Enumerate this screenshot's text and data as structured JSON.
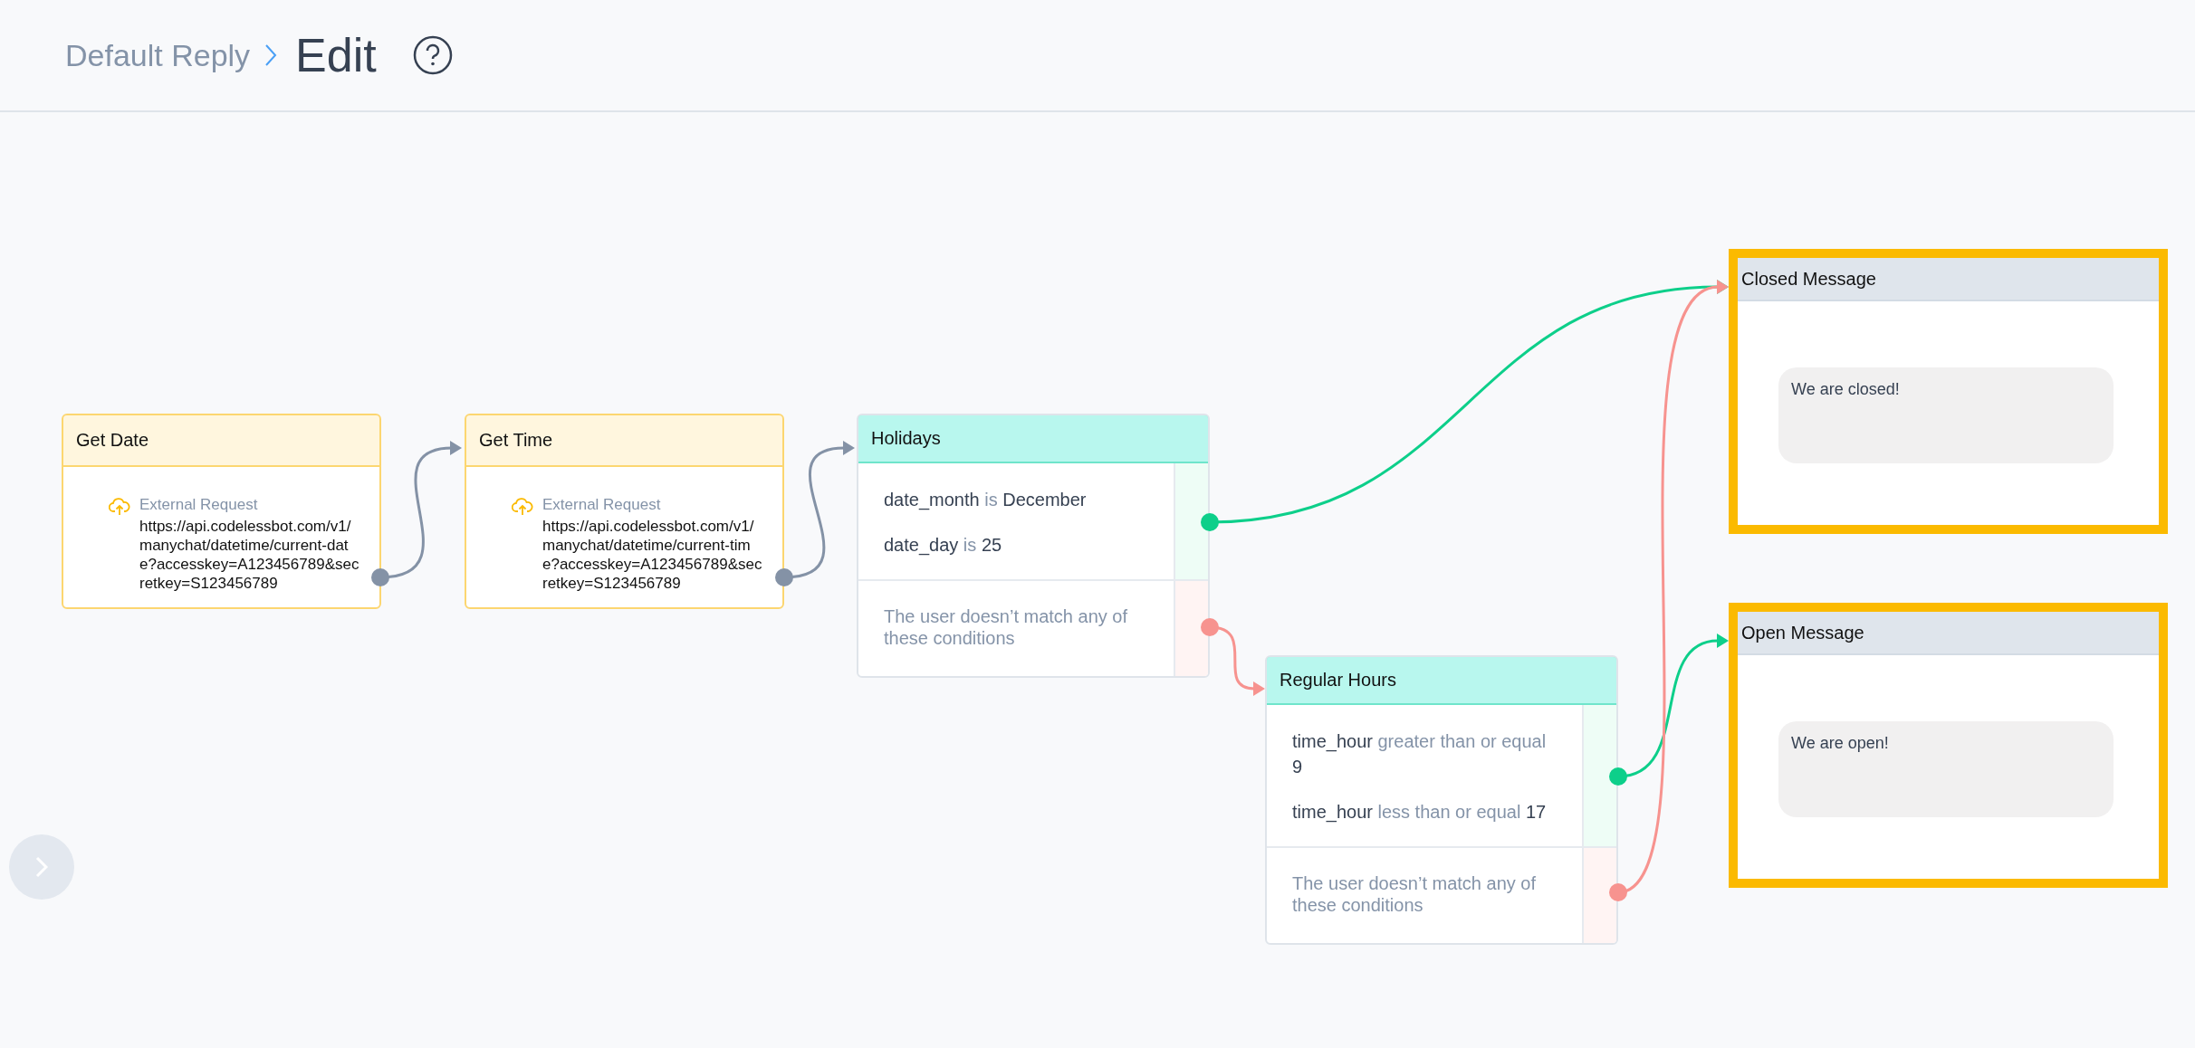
{
  "header": {
    "breadcrumb": "Default Reply",
    "title": "Edit"
  },
  "nodes": [
    {
      "kind": "request",
      "title": "Get Date",
      "selected": false,
      "label": "External Request",
      "url": "https://api.codelessbot.com/v1/manychat/datetime/current-date?accesskey=A123456789&secretkey=S123456789"
    },
    {
      "kind": "request",
      "title": "Get Time",
      "selected": false,
      "label": "External Request",
      "url": "https://api.codelessbot.com/v1/manychat/datetime/current-time?accesskey=A123456789&secretkey=S123456789"
    },
    {
      "kind": "condition",
      "title": "Holidays",
      "selected": false,
      "conditions": [
        {
          "field": "date_month",
          "operator": "is",
          "value": "December"
        },
        {
          "field": "date_day",
          "operator": "is",
          "value": "25"
        }
      ],
      "fallback": "The user doesn’t match any of these conditions"
    },
    {
      "kind": "condition",
      "title": "Regular Hours",
      "selected": false,
      "conditions": [
        {
          "field": "time_hour",
          "operator": "greater than or equal",
          "value": "9"
        },
        {
          "field": "time_hour",
          "operator": "less than or equal",
          "value": "17"
        }
      ],
      "fallback": "The user doesn’t match any of these conditions"
    },
    {
      "kind": "message",
      "title": "Closed Message",
      "selected": true,
      "text": "We are closed!"
    },
    {
      "kind": "message",
      "title": "Open Message",
      "selected": true,
      "text": "We are open!"
    }
  ]
}
